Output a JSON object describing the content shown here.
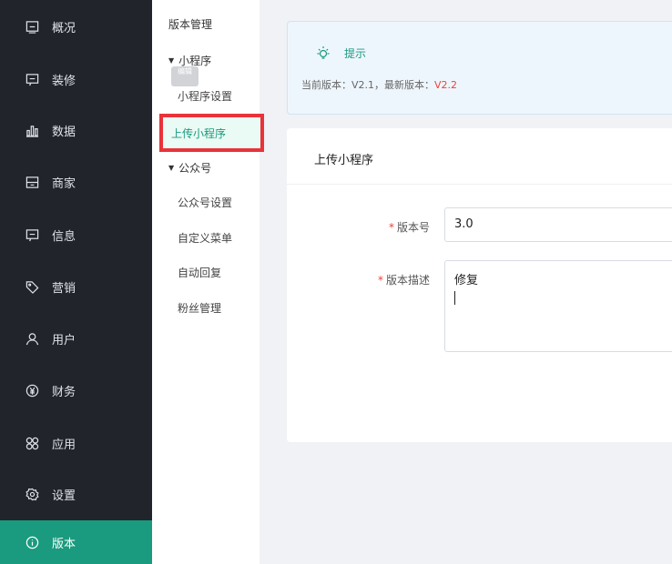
{
  "nav": {
    "items": [
      {
        "label": "概况",
        "icon": "screen-icon"
      },
      {
        "label": "装修",
        "icon": "chat-box-icon"
      },
      {
        "label": "数据",
        "icon": "bar-chart-icon"
      },
      {
        "label": "商家",
        "icon": "store-icon"
      },
      {
        "label": "信息",
        "icon": "message-icon"
      },
      {
        "label": "营销",
        "icon": "tag-icon"
      },
      {
        "label": "用户",
        "icon": "user-icon"
      },
      {
        "label": "财务",
        "icon": "yen-icon"
      },
      {
        "label": "应用",
        "icon": "apps-icon"
      },
      {
        "label": "设置",
        "icon": "gear-icon"
      },
      {
        "label": "版本",
        "icon": "info-icon"
      }
    ],
    "active_color": "#1a9a7e"
  },
  "sub": {
    "title": "版本管理",
    "groups": [
      {
        "label": "小程序",
        "items": [
          "小程序设置",
          "上传小程序"
        ]
      },
      {
        "label": "公众号",
        "items": [
          "公众号设置",
          "自定义菜单",
          "自动回复",
          "粉丝管理"
        ]
      }
    ],
    "tooltip": "编辑"
  },
  "notice": {
    "title": "提示",
    "current_prefix": "当前版本：V2.1，最新版本：",
    "latest": "V2.2"
  },
  "form": {
    "title": "上传小程序",
    "version_label": "版本号",
    "version_value": "3.0",
    "desc_label": "版本描述",
    "desc_value": "修复"
  }
}
